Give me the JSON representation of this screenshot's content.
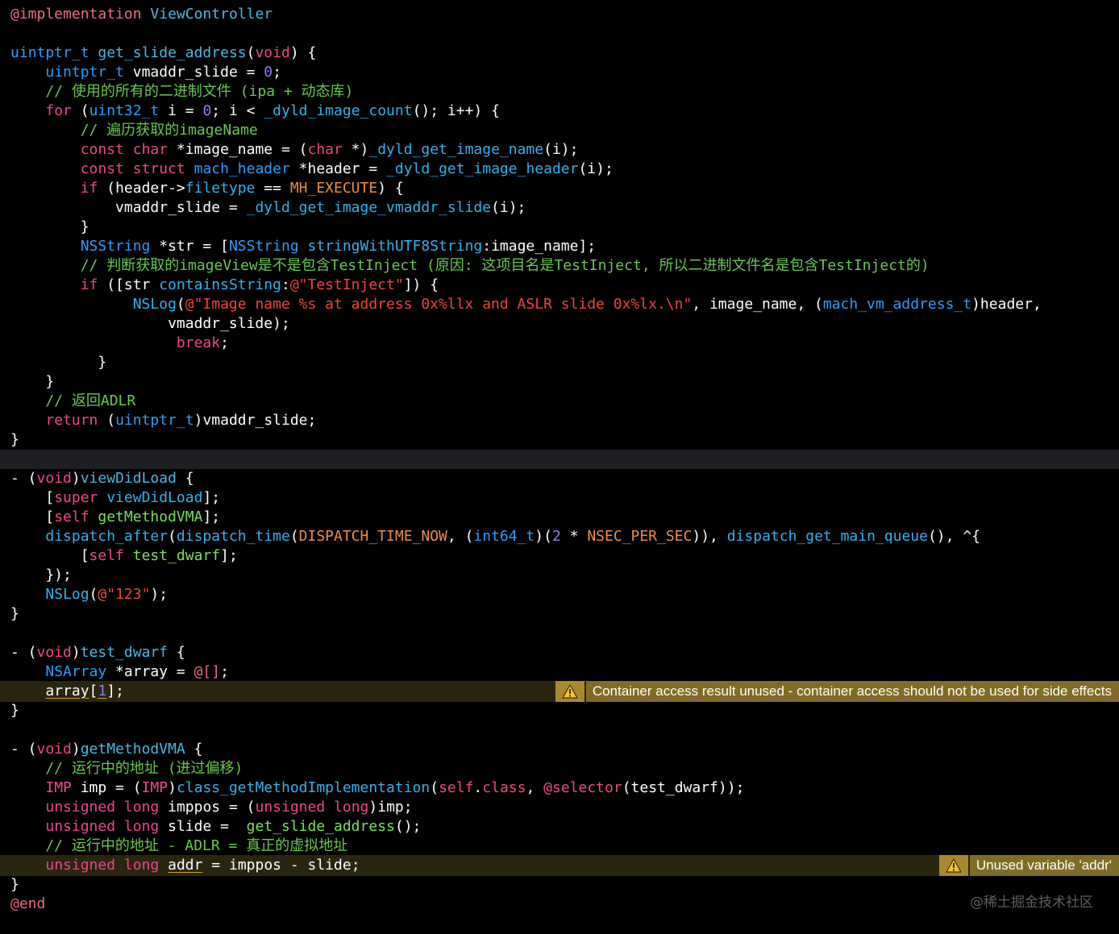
{
  "editor": {
    "lines": [
      {
        "tokens": [
          [
            "@implementation",
            "t-at"
          ],
          [
            " ",
            "t-pl"
          ],
          [
            "ViewController",
            "t-fw"
          ]
        ]
      },
      {
        "tokens": []
      },
      {
        "tokens": [
          [
            "uintptr_t",
            "t-ty"
          ],
          [
            " ",
            "t-pl"
          ],
          [
            "get_slide_address",
            "t-fw"
          ],
          [
            "(",
            "t-pl"
          ],
          [
            "void",
            "t-kw"
          ],
          [
            ") {",
            "t-pl"
          ]
        ]
      },
      {
        "tokens": [
          [
            "    ",
            "t-pl"
          ],
          [
            "uintptr_t",
            "t-ty"
          ],
          [
            " vmaddr_slide = ",
            "t-pl"
          ],
          [
            "0",
            "t-num"
          ],
          [
            ";",
            "t-pl"
          ]
        ]
      },
      {
        "tokens": [
          [
            "    // 使用的所有的二进制文件 (ipa + 动态库)",
            "t-com"
          ]
        ]
      },
      {
        "tokens": [
          [
            "    ",
            "t-pl"
          ],
          [
            "for",
            "t-kw"
          ],
          [
            " (",
            "t-pl"
          ],
          [
            "uint32_t",
            "t-ty"
          ],
          [
            " i = ",
            "t-pl"
          ],
          [
            "0",
            "t-num"
          ],
          [
            "; i < ",
            "t-pl"
          ],
          [
            "_dyld_image_count",
            "t-fn"
          ],
          [
            "(); i++) {",
            "t-pl"
          ]
        ]
      },
      {
        "tokens": [
          [
            "        // 遍历获取的imageName",
            "t-com"
          ]
        ]
      },
      {
        "tokens": [
          [
            "        ",
            "t-pl"
          ],
          [
            "const",
            "t-kw"
          ],
          [
            " ",
            "t-pl"
          ],
          [
            "char",
            "t-kw"
          ],
          [
            " *image_name = (",
            "t-pl"
          ],
          [
            "char",
            "t-kw"
          ],
          [
            " *)",
            "t-pl"
          ],
          [
            "_dyld_get_image_name",
            "t-fn"
          ],
          [
            "(i);",
            "t-pl"
          ]
        ]
      },
      {
        "tokens": [
          [
            "        ",
            "t-pl"
          ],
          [
            "const",
            "t-kw"
          ],
          [
            " ",
            "t-pl"
          ],
          [
            "struct",
            "t-kw"
          ],
          [
            " ",
            "t-pl"
          ],
          [
            "mach_header",
            "t-ty"
          ],
          [
            " *header = ",
            "t-pl"
          ],
          [
            "_dyld_get_image_header",
            "t-fn"
          ],
          [
            "(i);",
            "t-pl"
          ]
        ]
      },
      {
        "tokens": [
          [
            "        ",
            "t-pl"
          ],
          [
            "if",
            "t-kw"
          ],
          [
            " (header->",
            "t-pl"
          ],
          [
            "filetype",
            "t-fn"
          ],
          [
            " == ",
            "t-pl"
          ],
          [
            "MH_EXECUTE",
            "t-mac"
          ],
          [
            ") {",
            "t-pl"
          ]
        ]
      },
      {
        "tokens": [
          [
            "            vmaddr_slide = ",
            "t-pl"
          ],
          [
            "_dyld_get_image_vmaddr_slide",
            "t-fn"
          ],
          [
            "(i);",
            "t-pl"
          ]
        ]
      },
      {
        "tokens": [
          [
            "        }",
            "t-pl"
          ]
        ]
      },
      {
        "tokens": [
          [
            "        ",
            "t-pl"
          ],
          [
            "NSString",
            "t-ty"
          ],
          [
            " *str = [",
            "t-pl"
          ],
          [
            "NSString",
            "t-ty"
          ],
          [
            " ",
            "t-pl"
          ],
          [
            "stringWithUTF8String",
            "t-fn"
          ],
          [
            ":image_name];",
            "t-pl"
          ]
        ]
      },
      {
        "tokens": [
          [
            "        // 判断获取的imageView是不是包含TestInject (原因: 这项目名是TestInject, 所以二进制文件名是包含TestInject的)",
            "t-com"
          ]
        ]
      },
      {
        "tokens": [
          [
            "        ",
            "t-pl"
          ],
          [
            "if",
            "t-kw"
          ],
          [
            " ([str ",
            "t-pl"
          ],
          [
            "containsString",
            "t-fn"
          ],
          [
            ":",
            "t-pl"
          ],
          [
            "@\"TestInject\"",
            "t-str"
          ],
          [
            "]) {",
            "t-pl"
          ]
        ]
      },
      {
        "tokens": [
          [
            "              ",
            "t-pl"
          ],
          [
            "NSLog",
            "t-fn"
          ],
          [
            "(",
            "t-pl"
          ],
          [
            "@\"Image name %s at address 0x%llx and ASLR slide 0x%lx.\\n\"",
            "t-str"
          ],
          [
            ", image_name, (",
            "t-pl"
          ],
          [
            "mach_vm_address_t",
            "t-ty"
          ],
          [
            ")header,",
            "t-pl"
          ]
        ]
      },
      {
        "tokens": [
          [
            "                  vmaddr_slide);",
            "t-pl"
          ]
        ]
      },
      {
        "tokens": [
          [
            "                   ",
            "t-pl"
          ],
          [
            "break",
            "t-kw"
          ],
          [
            ";",
            "t-pl"
          ]
        ]
      },
      {
        "tokens": [
          [
            "          }",
            "t-pl"
          ]
        ]
      },
      {
        "tokens": [
          [
            "    }",
            "t-pl"
          ]
        ]
      },
      {
        "tokens": [
          [
            "    // 返回ADLR",
            "t-com"
          ]
        ]
      },
      {
        "tokens": [
          [
            "    ",
            "t-pl"
          ],
          [
            "return",
            "t-kw"
          ],
          [
            " (",
            "t-pl"
          ],
          [
            "uintptr_t",
            "t-ty"
          ],
          [
            ")vmaddr_slide;",
            "t-pl"
          ]
        ]
      },
      {
        "tokens": [
          [
            "}",
            "t-pl"
          ]
        ]
      },
      {
        "tokens": [],
        "current": true
      },
      {
        "tokens": [
          [
            "- (",
            "t-pl"
          ],
          [
            "void",
            "t-kw"
          ],
          [
            ")",
            "t-pl"
          ],
          [
            "viewDidLoad",
            "t-fw"
          ],
          [
            " {",
            "t-pl"
          ]
        ]
      },
      {
        "tokens": [
          [
            "    [",
            "t-pl"
          ],
          [
            "super",
            "t-kw"
          ],
          [
            " ",
            "t-pl"
          ],
          [
            "viewDidLoad",
            "t-fn"
          ],
          [
            "];",
            "t-pl"
          ]
        ]
      },
      {
        "tokens": [
          [
            "    [",
            "t-pl"
          ],
          [
            "self",
            "t-kw"
          ],
          [
            " ",
            "t-pl"
          ],
          [
            "getMethodVMA",
            "t-gf"
          ],
          [
            "];",
            "t-pl"
          ]
        ]
      },
      {
        "tokens": [
          [
            "    ",
            "t-pl"
          ],
          [
            "dispatch_after",
            "t-fn"
          ],
          [
            "(",
            "t-pl"
          ],
          [
            "dispatch_time",
            "t-fn"
          ],
          [
            "(",
            "t-pl"
          ],
          [
            "DISPATCH_TIME_NOW",
            "t-mac"
          ],
          [
            ", (",
            "t-pl"
          ],
          [
            "int64_t",
            "t-ty"
          ],
          [
            ")(",
            "t-pl"
          ],
          [
            "2",
            "t-num"
          ],
          [
            " * ",
            "t-pl"
          ],
          [
            "NSEC_PER_SEC",
            "t-mac"
          ],
          [
            ")), ",
            "t-pl"
          ],
          [
            "dispatch_get_main_queue",
            "t-fn"
          ],
          [
            "(), ^{",
            "t-pl"
          ]
        ]
      },
      {
        "tokens": [
          [
            "        [",
            "t-pl"
          ],
          [
            "self",
            "t-kw"
          ],
          [
            " ",
            "t-pl"
          ],
          [
            "test_dwarf",
            "t-gf"
          ],
          [
            "];",
            "t-pl"
          ]
        ]
      },
      {
        "tokens": [
          [
            "    });",
            "t-pl"
          ]
        ]
      },
      {
        "tokens": [
          [
            "    ",
            "t-pl"
          ],
          [
            "NSLog",
            "t-fn"
          ],
          [
            "(",
            "t-pl"
          ],
          [
            "@\"123\"",
            "t-str"
          ],
          [
            ");",
            "t-pl"
          ]
        ]
      },
      {
        "tokens": [
          [
            "}",
            "t-pl"
          ]
        ]
      },
      {
        "tokens": []
      },
      {
        "tokens": [
          [
            "- (",
            "t-pl"
          ],
          [
            "void",
            "t-kw"
          ],
          [
            ")",
            "t-pl"
          ],
          [
            "test_dwarf",
            "t-fw"
          ],
          [
            " {",
            "t-pl"
          ]
        ]
      },
      {
        "tokens": [
          [
            "    ",
            "t-pl"
          ],
          [
            "NSArray",
            "t-ty"
          ],
          [
            " *array = ",
            "t-pl"
          ],
          [
            "@[]",
            "t-at"
          ],
          [
            ";",
            "t-pl"
          ]
        ]
      },
      {
        "tokens": [
          [
            "    ",
            "t-pl"
          ],
          [
            "array",
            "t-pl t-ul"
          ],
          [
            "[",
            "t-pl"
          ],
          [
            "1",
            "t-num t-ul"
          ],
          [
            "];",
            "t-pl"
          ]
        ],
        "warning": {
          "message": "Container access result unused - container access should not be used for side effects"
        }
      },
      {
        "tokens": [
          [
            "}",
            "t-pl"
          ]
        ]
      },
      {
        "tokens": []
      },
      {
        "tokens": [
          [
            "- (",
            "t-pl"
          ],
          [
            "void",
            "t-kw"
          ],
          [
            ")",
            "t-pl"
          ],
          [
            "getMethodVMA",
            "t-fw"
          ],
          [
            " {",
            "t-pl"
          ]
        ]
      },
      {
        "tokens": [
          [
            "    // 运行中的地址 (进过偏移)",
            "t-com"
          ]
        ]
      },
      {
        "tokens": [
          [
            "    ",
            "t-pl"
          ],
          [
            "IMP",
            "t-kw"
          ],
          [
            " imp = (",
            "t-pl"
          ],
          [
            "IMP",
            "t-kw"
          ],
          [
            ")",
            "t-pl"
          ],
          [
            "class_getMethodImplementation",
            "t-fn"
          ],
          [
            "(",
            "t-pl"
          ],
          [
            "self",
            "t-kw"
          ],
          [
            ".",
            "t-pl"
          ],
          [
            "class",
            "t-kw"
          ],
          [
            ", ",
            "t-pl"
          ],
          [
            "@selector",
            "t-kw"
          ],
          [
            "(test_dwarf));",
            "t-pl"
          ]
        ]
      },
      {
        "tokens": [
          [
            "    ",
            "t-pl"
          ],
          [
            "unsigned",
            "t-kw"
          ],
          [
            " ",
            "t-pl"
          ],
          [
            "long",
            "t-kw"
          ],
          [
            " imppos = (",
            "t-pl"
          ],
          [
            "unsigned",
            "t-kw"
          ],
          [
            " ",
            "t-pl"
          ],
          [
            "long",
            "t-kw"
          ],
          [
            ")imp;",
            "t-pl"
          ]
        ]
      },
      {
        "tokens": [
          [
            "    ",
            "t-pl"
          ],
          [
            "unsigned",
            "t-kw"
          ],
          [
            " ",
            "t-pl"
          ],
          [
            "long",
            "t-kw"
          ],
          [
            " slide =  ",
            "t-pl"
          ],
          [
            "get_slide_address",
            "t-gf"
          ],
          [
            "();",
            "t-pl"
          ]
        ]
      },
      {
        "tokens": [
          [
            "    // 运行中的地址 - ADLR = 真正的虚拟地址",
            "t-com"
          ]
        ]
      },
      {
        "tokens": [
          [
            "    ",
            "t-pl"
          ],
          [
            "unsigned",
            "t-kw"
          ],
          [
            " ",
            "t-pl"
          ],
          [
            "long",
            "t-kw"
          ],
          [
            " ",
            "t-pl"
          ],
          [
            "addr",
            "t-pl t-ul"
          ],
          [
            " = imppos - slide;",
            "t-pl"
          ]
        ],
        "warning": {
          "message": "Unused variable 'addr'"
        }
      },
      {
        "tokens": [
          [
            "}",
            "t-pl"
          ]
        ]
      },
      {
        "tokens": [
          [
            "@end",
            "t-at"
          ]
        ]
      }
    ],
    "warning_icon": "warning-triangle-icon",
    "watermark": "@稀土掘金技术社区"
  }
}
